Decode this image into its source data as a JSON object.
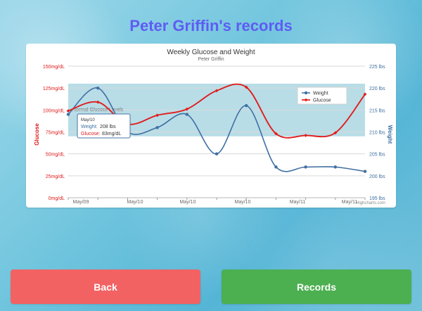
{
  "title": "Peter Griffin's records",
  "buttons": {
    "back_label": "Back",
    "records_label": "Records"
  },
  "colors": {
    "title": "#5f5cf3",
    "back": "#f26262",
    "records": "#4caf50",
    "glucose": "#e11d1d",
    "weight": "#3f6fa4",
    "band": "#b8dde7"
  },
  "chart_data": {
    "type": "line",
    "title": "Weekly Glucose and Weight",
    "subtitle": "Peter Griffin",
    "x_labels": [
      "May/09",
      "May/10",
      "May/10",
      "May/10",
      "May/11",
      "May/11"
    ],
    "x_count": 11,
    "series": [
      {
        "name": "Weight",
        "color": "#3f6fa4",
        "values": [
          214,
          220,
          210,
          211,
          214,
          205,
          216,
          202,
          202,
          202,
          201
        ]
      },
      {
        "name": "Glucose",
        "color": "#e11d1d",
        "values": [
          99,
          109,
          84,
          94,
          101,
          122,
          126,
          73,
          71,
          74,
          118
        ]
      }
    ],
    "left_axis": {
      "label": "Glucose",
      "min": 0,
      "max": 150,
      "ticks": [
        "0mg/dL",
        "25mg/dL",
        "50mg/dL",
        "75mg/dL",
        "100mg/dL",
        "125mg/dL",
        "150mg/dL"
      ]
    },
    "right_axis": {
      "label": "Weight",
      "min": 195,
      "max": 225,
      "ticks": [
        "195 lbs",
        "200 lbs",
        "205 lbs",
        "210 lbs",
        "215 lbs",
        "220 lbs",
        "225 lbs"
      ]
    },
    "normal_band": {
      "label": "Normal Glucose Levels",
      "from": 70,
      "to": 130
    },
    "legend": [
      "Weight",
      "Glucose"
    ],
    "tooltip": {
      "date": "May/10",
      "weight_label": "Weight:",
      "weight_value": "208 lbs",
      "glucose_label": "Glucose:",
      "glucose_value": "83mg/dL"
    },
    "credits": "Highcharts.com"
  }
}
